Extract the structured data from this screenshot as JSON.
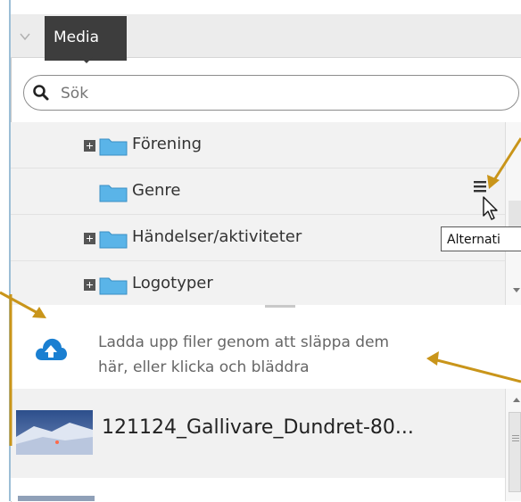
{
  "panel": {
    "tab_label": "Media",
    "search": {
      "placeholder": "Sök"
    }
  },
  "tree": {
    "items": [
      {
        "label": "Förening",
        "expandable": true
      },
      {
        "label": "Genre",
        "expandable": false
      },
      {
        "label": "Händelser/aktiviteter",
        "expandable": true
      },
      {
        "label": "Logotyper",
        "expandable": true
      }
    ]
  },
  "tooltip": {
    "text": "Alternati"
  },
  "upload": {
    "line1": "Ladda upp filer genom att släppa dem",
    "line2": "här, eller klicka och bläddra"
  },
  "media_list": {
    "items": [
      {
        "label": "121124_Gallivare_Dundret-80..."
      }
    ]
  },
  "icons": [
    "chevron-down-icon",
    "search-icon",
    "expand-icon",
    "folder-icon",
    "options-menu-icon",
    "cursor-icon",
    "cloud-upload-icon",
    "scroll-up-icon",
    "scroll-down-icon"
  ],
  "colors": {
    "tab_bg": "#3d3d3d",
    "folder": "#5ab4e8",
    "cloud": "#1a7fd1",
    "arrow_annotation": "#c9951a",
    "tree_bg": "#f2f2f2"
  }
}
